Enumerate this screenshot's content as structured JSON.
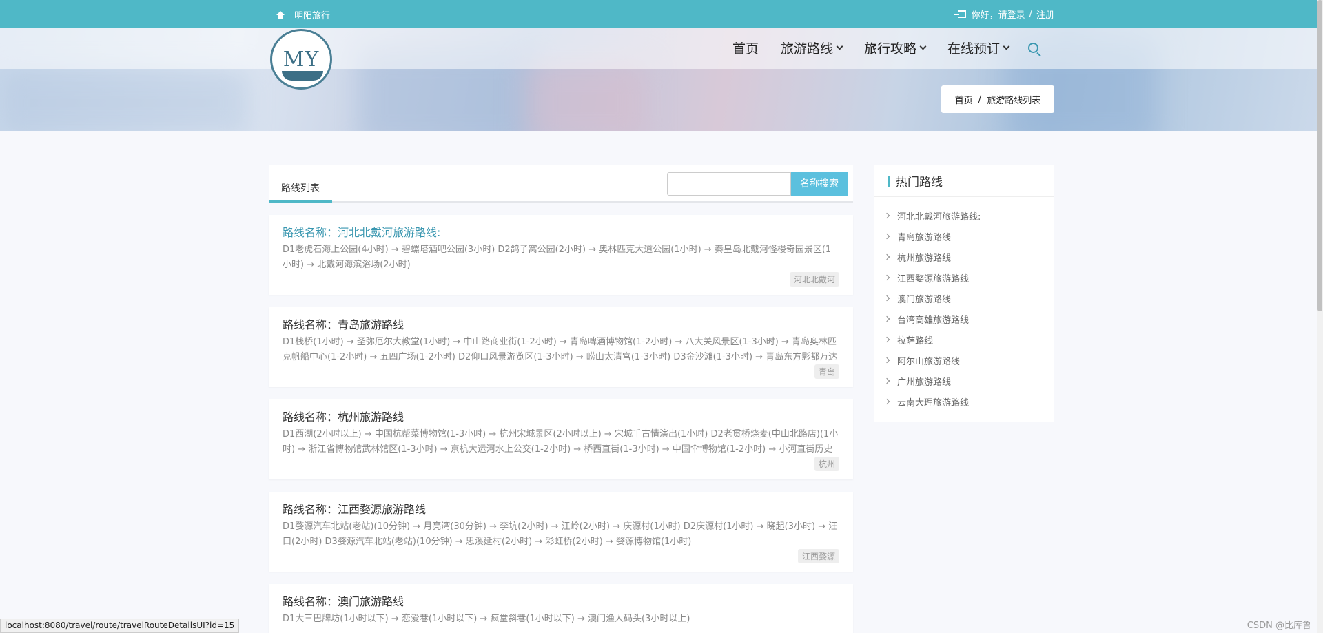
{
  "topbar": {
    "brand": "明阳旅行",
    "greeting": "你好，请登录",
    "sep": "/",
    "register": "注册"
  },
  "logo": {
    "text": "MY"
  },
  "nav": {
    "home": "首页",
    "routes": "旅游路线",
    "guides": "旅行攻略",
    "booking": "在线预订"
  },
  "breadcrumb": {
    "home": "首页",
    "sep": "/",
    "current": "旅游路线列表"
  },
  "main": {
    "tab": "路线列表",
    "search_button": "名称搜索",
    "search_value": "",
    "name_prefix": "路线名称：",
    "routes": [
      {
        "name": "河北北戴河旅游路线:",
        "desc": "D1老虎石海上公园(4小时) → 碧螺塔酒吧公园(3小时) D2鸽子窝公园(2小时) → 奥林匹克大道公园(1小时) → 秦皇岛北戴河怪楼奇园景区(1小时) → 北戴河海滨浴场(2小时)",
        "tag": "河北北戴河"
      },
      {
        "name": "青岛旅游路线",
        "desc": "D1栈桥(1小时) → 圣弥厄尔大教堂(1小时) → 中山路商业街(1-2小时) → 青岛啤酒博物馆(1-2小时) → 八大关风景区(1-3小时) → 青岛奥林匹克帆船中心(1-2小时) → 五四广场(1-2小时) D2仰口风景游览区(1-3小时) → 崂山太清宫(1-3小时) D3金沙滩(1-3小时) → 青岛东方影都万达乐园",
        "tag": "青岛"
      },
      {
        "name": "杭州旅游路线",
        "desc": "D1西湖(2小时以上) → 中国杭帮菜博物馆(1-3小时) → 杭州宋城景区(2小时以上) → 宋城千古情演出(1小时) D2老贯桥烧麦(中山北路店)(1小时) → 浙江省博物馆武林馆区(1-3小时) → 京杭大运河水上公交(1-2小时) → 桥西直街(1-3小时) → 中国伞博物馆(1-2小时) → 小河直街历史文",
        "tag": "杭州"
      },
      {
        "name": "江西婺源旅游路线",
        "desc": "D1婺源汽车北站(老站)(10分钟) → 月亮湾(30分钟) → 李坑(2小时) → 江岭(2小时) → 庆源村(1小时) D2庆源村(1小时) → 晓起(3小时) → 汪口(2小时) D3婺源汽车北站(老站)(10分钟) → 思溪延村(2小时) → 彩虹桥(2小时) → 婺源博物馆(1小时)",
        "tag": "江西婺源"
      },
      {
        "name": "澳门旅游路线",
        "desc": "D1大三巴牌坊(1小时以下) → 恋爱巷(1小时以下) → 疯堂斜巷(1小时以下) → 澳门渔人码头(3小时以上)",
        "tag": ""
      }
    ]
  },
  "sidebar": {
    "title": "热门路线",
    "items": [
      "河北北戴河旅游路线:",
      "青岛旅游路线",
      "杭州旅游路线",
      "江西婺源旅游路线",
      "澳门旅游路线",
      "台湾高雄旅游路线",
      "拉萨路线",
      "阿尔山旅游路线",
      "广州旅游路线",
      "云南大理旅游路线"
    ]
  },
  "statusbar": {
    "url": "localhost:8080/travel/route/travelRouteDetailsUI?id=15"
  },
  "watermark": "CSDN @比库鲁",
  "colors": {
    "accent": "#4fb8c7",
    "search_button": "#5bc0de",
    "link": "#3a97b0"
  }
}
